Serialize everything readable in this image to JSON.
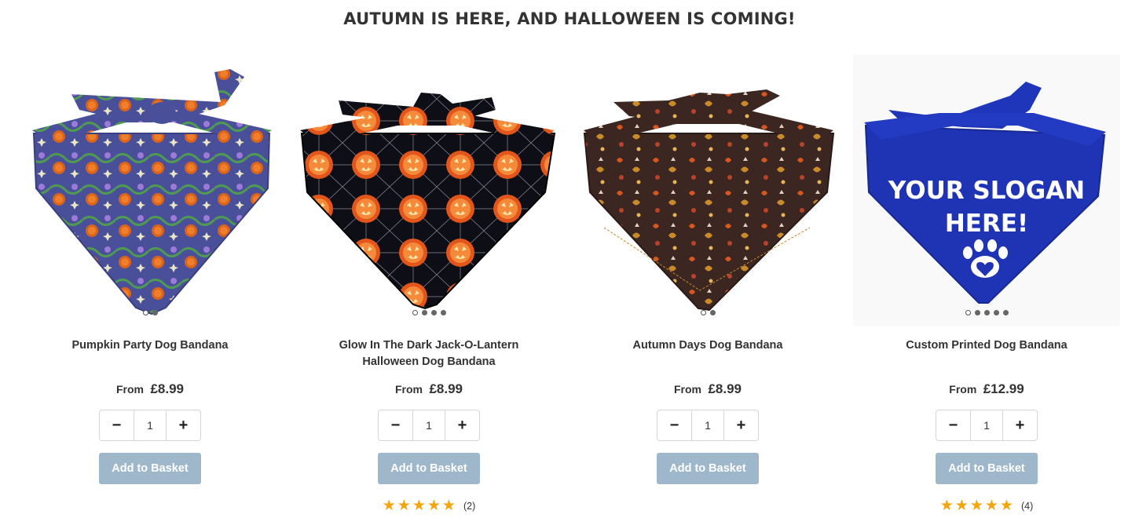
{
  "heading": "AUTUMN IS HERE, AND HALLOWEEN IS COMING!",
  "colors": {
    "button": "#9fb7cb",
    "star": "#f2a50c",
    "text": "#333333"
  },
  "products": [
    {
      "name": "Pumpkin Party Dog Bandana",
      "price_prefix": "From",
      "price": "£8.99",
      "quantity": "1",
      "minus_label": "−",
      "plus_label": "+",
      "button_label": "Add to Basket",
      "image_dots": 2,
      "active_dot": 0,
      "rating": null,
      "review_count": null
    },
    {
      "name": "Glow In The Dark Jack-O-Lantern Halloween Dog Bandana",
      "price_prefix": "From",
      "price": "£8.99",
      "quantity": "1",
      "minus_label": "−",
      "plus_label": "+",
      "button_label": "Add to Basket",
      "image_dots": 4,
      "active_dot": 0,
      "rating": 5,
      "review_count": "(2)"
    },
    {
      "name": "Autumn Days Dog Bandana",
      "price_prefix": "From",
      "price": "£8.99",
      "quantity": "1",
      "minus_label": "−",
      "plus_label": "+",
      "button_label": "Add to Basket",
      "image_dots": 2,
      "active_dot": 0,
      "rating": null,
      "review_count": null
    },
    {
      "name": "Custom Printed Dog Bandana",
      "price_prefix": "From",
      "price": "£12.99",
      "quantity": "1",
      "minus_label": "−",
      "plus_label": "+",
      "button_label": "Add to Basket",
      "image_dots": 5,
      "active_dot": 0,
      "rating": 5,
      "review_count": "(4)",
      "image_text_line1": "YOUR SLOGAN",
      "image_text_line2": "HERE!"
    }
  ]
}
